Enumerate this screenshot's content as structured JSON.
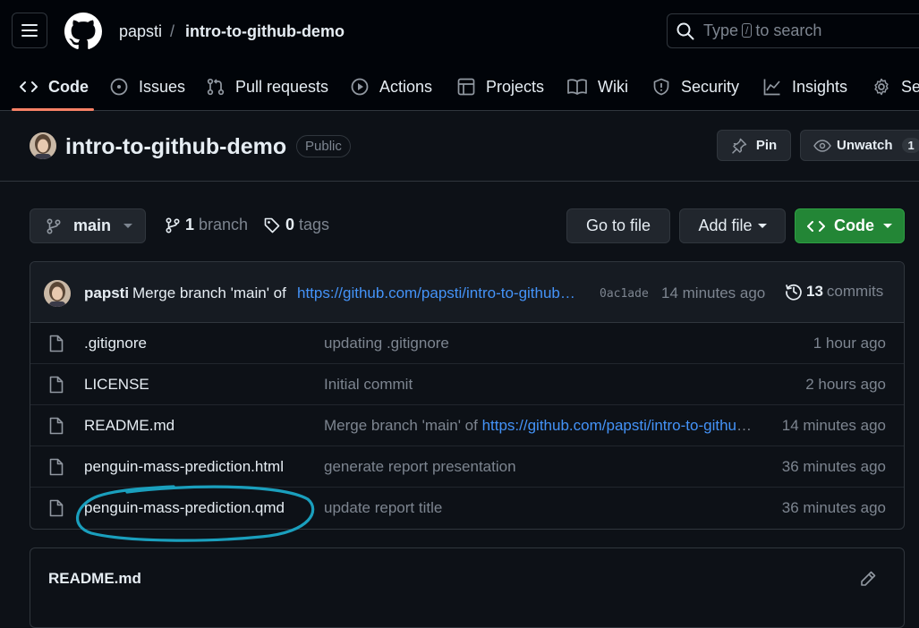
{
  "header": {
    "owner": "papsti",
    "separator": "/",
    "repo": "intro-to-github-demo",
    "search_prefix": "Type",
    "search_key": "/",
    "search_suffix": "to search"
  },
  "nav": {
    "tabs": [
      {
        "label": "Code",
        "icon": "code-icon",
        "active": true
      },
      {
        "label": "Issues",
        "icon": "issue-icon"
      },
      {
        "label": "Pull requests",
        "icon": "pull-request-icon"
      },
      {
        "label": "Actions",
        "icon": "play-icon"
      },
      {
        "label": "Projects",
        "icon": "table-icon"
      },
      {
        "label": "Wiki",
        "icon": "book-icon"
      },
      {
        "label": "Security",
        "icon": "shield-icon"
      },
      {
        "label": "Insights",
        "icon": "graph-icon"
      },
      {
        "label": "Settings",
        "icon": "gear-icon"
      }
    ]
  },
  "repo": {
    "name": "intro-to-github-demo",
    "visibility": "Public",
    "pin_label": "Pin",
    "unwatch_label": "Unwatch",
    "watch_count": "1"
  },
  "branch_bar": {
    "branch": "main",
    "branch_count": "1",
    "branch_word": "branch",
    "tag_count": "0",
    "tag_word": "tags",
    "go_to_file": "Go to file",
    "add_file": "Add file",
    "code": "Code"
  },
  "latest_commit": {
    "author": "papsti",
    "message": "Merge branch 'main' of",
    "link": "https://github.com/papsti/intro-to-github-demo",
    "sha": "0ac1ade",
    "time": "14 minutes ago",
    "commit_count": "13",
    "commit_word": "commits"
  },
  "files": [
    {
      "name": ".gitignore",
      "message": "updating .gitignore",
      "link": "",
      "time": "1 hour ago"
    },
    {
      "name": "LICENSE",
      "message": "Initial commit",
      "link": "",
      "time": "2 hours ago"
    },
    {
      "name": "README.md",
      "message": "Merge branch 'main' of ",
      "link": "https://github.com/papsti/intro-to-github-demo",
      "time": "14 minutes ago"
    },
    {
      "name": "penguin-mass-prediction.html",
      "message": "generate report presentation",
      "link": "",
      "time": "36 minutes ago"
    },
    {
      "name": "penguin-mass-prediction.qmd",
      "message": "update report title",
      "link": "",
      "time": "36 minutes ago"
    }
  ],
  "readme": {
    "title": "README.md"
  },
  "colors": {
    "background": "#0d1117",
    "link": "#4493f8",
    "accent_underline": "#f78166",
    "code_button": "#238636",
    "annotation": "#1a9fbd"
  }
}
